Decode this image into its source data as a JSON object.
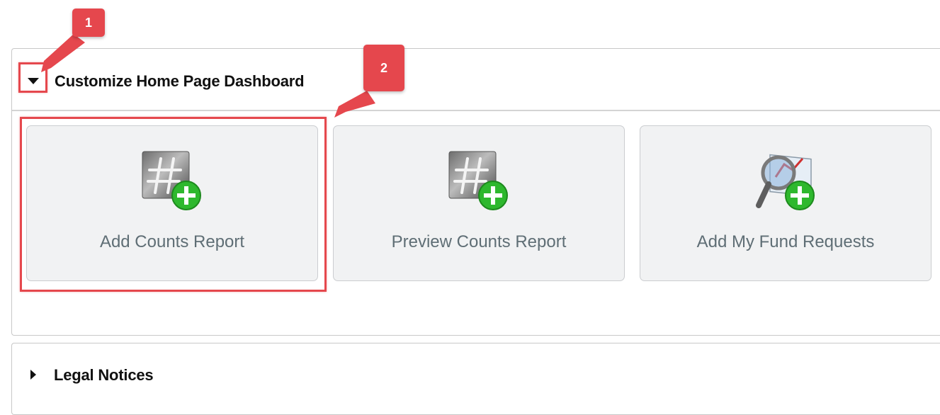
{
  "dashboard_panel": {
    "title": "Customize Home Page Dashboard",
    "expanded": true,
    "tiles": [
      {
        "label": "Add Counts Report",
        "icon": "hash-add-icon"
      },
      {
        "label": "Preview Counts Report",
        "icon": "hash-add-icon"
      },
      {
        "label": "Add My Fund Requests",
        "icon": "magnifier-chart-add-icon"
      }
    ]
  },
  "legal_panel": {
    "title": "Legal Notices",
    "expanded": false
  },
  "annotations": {
    "callout_1": "1",
    "callout_2": "2",
    "color": "#e5474d"
  },
  "colors": {
    "tile_background": "#f1f2f3",
    "tile_label": "#5f6e75",
    "plus_badge": "#2eb82e"
  }
}
